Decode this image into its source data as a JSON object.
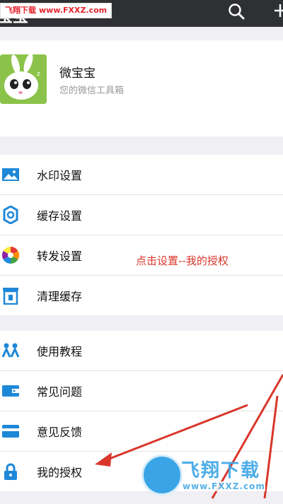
{
  "header": {
    "title": "宝宝",
    "watermark_label": "飞翔下载",
    "watermark_site": "www.FXXZ.com"
  },
  "profile": {
    "name": "微宝宝",
    "subtitle": "您的微信工具箱"
  },
  "menu_groups": [
    [
      {
        "label": "水印设置",
        "icon": "image-icon"
      },
      {
        "label": "缓存设置",
        "icon": "gear-icon"
      },
      {
        "label": "转发设置",
        "icon": "aperture-icon"
      },
      {
        "label": "清理缓存",
        "icon": "trash-icon"
      }
    ],
    [
      {
        "label": "使用教程",
        "icon": "people-icon"
      },
      {
        "label": "常见问题",
        "icon": "wallet-icon"
      },
      {
        "label": "意见反馈",
        "icon": "card-icon"
      },
      {
        "label": "我的授权",
        "icon": "lock-icon"
      }
    ]
  ],
  "annotation": "点击设置--我的授权",
  "watermark": {
    "brand": "飞翔下载",
    "site": "www.FXXZ.com"
  },
  "colors": {
    "topbar": "#2e3033",
    "icon_blue": "#1e88d8",
    "annotation_red": "#d9362b",
    "watermark_blue": "#39a5e6"
  }
}
